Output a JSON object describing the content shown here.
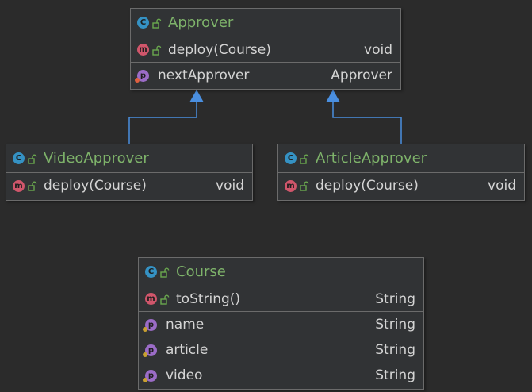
{
  "colors": {
    "background": "#2b2b2b",
    "box": "#313335",
    "border": "#6b6b6b",
    "class_name": "#7eb36a",
    "text": "#d4d4d4",
    "class_badge": "#3592c4",
    "method_badge": "#d0566b",
    "property_badge": "#9b6cc7",
    "inheritance_arrow": "#4a8fe0"
  },
  "badges": {
    "class": "C",
    "method": "m",
    "property": "p"
  },
  "classes": {
    "approver": {
      "name": "Approver",
      "methods": [
        {
          "name": "deploy(Course)",
          "type": "void"
        }
      ],
      "fields": [
        {
          "name": "nextApprover",
          "type": "Approver"
        }
      ]
    },
    "video_approver": {
      "name": "VideoApprover",
      "methods": [
        {
          "name": "deploy(Course)",
          "type": "void"
        }
      ]
    },
    "article_approver": {
      "name": "ArticleApprover",
      "methods": [
        {
          "name": "deploy(Course)",
          "type": "void"
        }
      ]
    },
    "course": {
      "name": "Course",
      "methods": [
        {
          "name": "toString()",
          "type": "String"
        }
      ],
      "fields": [
        {
          "name": "name",
          "type": "String"
        },
        {
          "name": "article",
          "type": "String"
        },
        {
          "name": "video",
          "type": "String"
        }
      ]
    }
  },
  "relations": [
    {
      "type": "inheritance",
      "from": "VideoApprover",
      "to": "Approver"
    },
    {
      "type": "inheritance",
      "from": "ArticleApprover",
      "to": "Approver"
    }
  ]
}
